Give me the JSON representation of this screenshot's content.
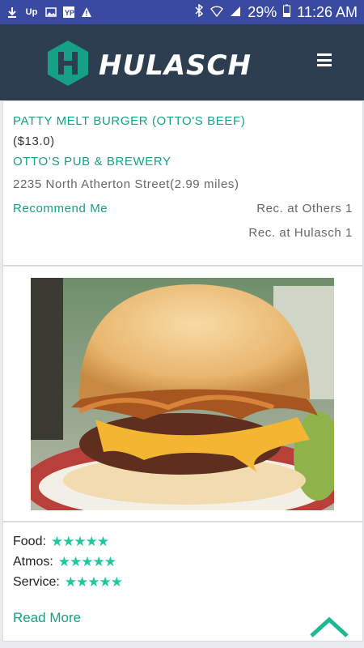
{
  "status_bar": {
    "battery": "29%",
    "time": "11:26 AM"
  },
  "header": {
    "logo_text": "HULASCH",
    "menu_icon": "hamburger-menu-icon"
  },
  "listing": {
    "item_name": "PATTY MELT BURGER (OTTO'S BEEF)",
    "price": "($13.0)",
    "restaurant": "OTTO’S PUB & BREWERY",
    "address": "2235 North Atherton Street(2.99 miles)",
    "recommend_label": "Recommend Me",
    "rec_others": "Rec. at Others 1",
    "rec_hulasch": "Rec. at Hulasch 1"
  },
  "ratings": {
    "food_label": "Food:",
    "food_stars": 5,
    "atmos_label": "Atmos:",
    "atmos_stars": 5,
    "service_label": "Service:",
    "service_stars": 5,
    "star_glyphs": "★★★★★",
    "read_more": "Read More"
  },
  "colors": {
    "accent": "#16a085",
    "header_bg": "#2d3e50",
    "status_bg": "#3a4aa0",
    "star": "#1fc7a0"
  }
}
